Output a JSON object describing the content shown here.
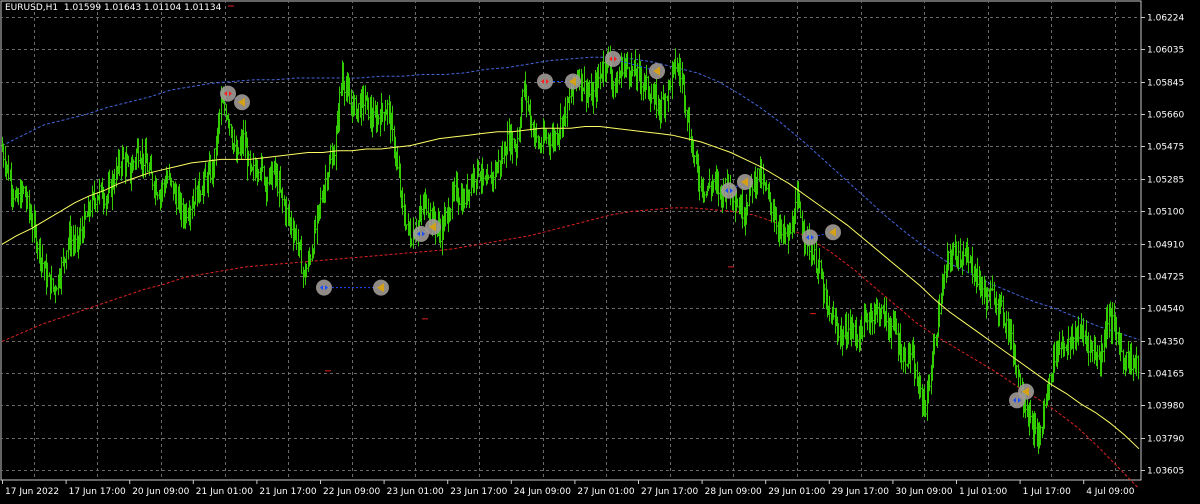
{
  "header": {
    "symbol": "EURUSD,H1",
    "ohlc": "1.01599 1.01643 1.01104 1.01134"
  },
  "chart_data": {
    "type": "line",
    "title": "EURUSD,H1",
    "grid": true,
    "ylim": [
      1.0355,
      1.0632
    ],
    "y_ticks": [
      1.06224,
      1.06035,
      1.05845,
      1.0566,
      1.05475,
      1.05285,
      1.051,
      1.0491,
      1.04725,
      1.0454,
      1.0435,
      1.04165,
      1.0398,
      1.0379,
      1.03605
    ],
    "y_tick_labels": [
      "1.06224",
      "1.06035",
      "1.05845",
      "1.05660",
      "1.05475",
      "1.05285",
      "1.05100",
      "1.04910",
      "1.04725",
      "1.04540",
      "1.04350",
      "1.04165",
      "1.03980",
      "1.03790",
      "1.03605"
    ],
    "x_tick_labels": [
      "17 Jun 2022",
      "17 Jun 17:00",
      "20 Jun 09:00",
      "21 Jun 01:00",
      "21 Jun 17:00",
      "22 Jun 09:00",
      "23 Jun 01:00",
      "23 Jun 17:00",
      "24 Jun 09:00",
      "27 Jun 01:00",
      "27 Jun 17:00",
      "28 Jun 09:00",
      "29 Jun 01:00",
      "29 Jun 17:00",
      "30 Jun 09:00",
      "1 Jul 01:00",
      "1 Jul 17:00",
      "4 Jul 09:00"
    ],
    "colors": {
      "price": "#33cc00",
      "ma": "#ffff66",
      "upper_band": "#4466dd",
      "lower_band": "#dd2222",
      "grid": "#6a6a6a",
      "marker_ring": "#a09a96",
      "buy": "#1a4dff",
      "sell": "#ff2020",
      "close_arrow": "#d4a017"
    },
    "series": [
      {
        "values": [
          1.0548,
          1.0532,
          1.0515,
          1.0522,
          1.0505,
          1.0489,
          1.0472,
          1.0465,
          1.0478,
          1.0495,
          1.049,
          1.0503,
          1.0515,
          1.0522,
          1.0518,
          1.053,
          1.0541,
          1.0532,
          1.0546,
          1.0539,
          1.0528,
          1.0521,
          1.053,
          1.0519,
          1.0508,
          1.0514,
          1.0522,
          1.0528,
          1.0535,
          1.0572,
          1.0566,
          1.054,
          1.0552,
          1.053,
          1.0538,
          1.0527,
          1.0533,
          1.0518,
          1.0505,
          1.0495,
          1.0472,
          1.0488,
          1.0512,
          1.0532,
          1.0545,
          1.059,
          1.0572,
          1.0569,
          1.0575,
          1.0562,
          1.0566,
          1.057,
          1.0545,
          1.051,
          1.0495,
          1.0503,
          1.0516,
          1.0505,
          1.0498,
          1.051,
          1.0522,
          1.0515,
          1.0528,
          1.0535,
          1.0523,
          1.0532,
          1.054,
          1.0553,
          1.0547,
          1.0582,
          1.056,
          1.0547,
          1.0553,
          1.0552,
          1.0563,
          1.0574,
          1.059,
          1.0582,
          1.0575,
          1.0589,
          1.0599,
          1.058,
          1.0595,
          1.0592,
          1.0588,
          1.0584,
          1.0575,
          1.057,
          1.0581,
          1.0595,
          1.0585,
          1.055,
          1.053,
          1.0522,
          1.0527,
          1.052,
          1.0527,
          1.0516,
          1.051,
          1.0525,
          1.0532,
          1.052,
          1.0509,
          1.0496,
          1.0495,
          1.0515,
          1.0498,
          1.0487,
          1.0476,
          1.0452,
          1.0446,
          1.0437,
          1.0443,
          1.0438,
          1.0446,
          1.0452,
          1.0453,
          1.0445,
          1.0442,
          1.0425,
          1.0428,
          1.0408,
          1.0398,
          1.0428,
          1.046,
          1.0483,
          1.0487,
          1.0484,
          1.0479,
          1.047,
          1.046,
          1.0462,
          1.0453,
          1.0442,
          1.042,
          1.0402,
          1.0385,
          1.0378,
          1.0405,
          1.0428,
          1.0435,
          1.0432,
          1.0441,
          1.0438,
          1.043,
          1.0425,
          1.045,
          1.0442,
          1.0426,
          1.0424,
          1.042
        ]
      },
      {
        "values": [
          1.0491,
          1.0496,
          1.05,
          1.0505,
          1.051,
          1.0515,
          1.0519,
          1.0522,
          1.0526,
          1.0529,
          1.0532,
          1.0534,
          1.0536,
          1.0538,
          1.0539,
          1.054,
          1.054,
          1.054,
          1.0541,
          1.0542,
          1.0543,
          1.0544,
          1.0544,
          1.0545,
          1.0545,
          1.0546,
          1.0546,
          1.0547,
          1.0548,
          1.055,
          1.0552,
          1.0553,
          1.0554,
          1.0555,
          1.0556,
          1.0556,
          1.0557,
          1.0558,
          1.0558,
          1.0558,
          1.0559,
          1.0559,
          1.0558,
          1.0557,
          1.0556,
          1.0555,
          1.0554,
          1.0552,
          1.055,
          1.0547,
          1.0544,
          1.054,
          1.0536,
          1.0531,
          1.0526,
          1.052,
          1.0514,
          1.0508,
          1.0502,
          1.0495,
          1.0488,
          1.0481,
          1.0474,
          1.0467,
          1.0459,
          1.0452,
          1.0446,
          1.044,
          1.0434,
          1.0428,
          1.0422,
          1.0416,
          1.041,
          1.0405,
          1.0399,
          1.0394,
          1.0388,
          1.0381,
          1.0373
        ]
      },
      {
        "values": [
          1.0548,
          1.0554,
          1.056,
          1.0563,
          1.0566,
          1.057,
          1.0573,
          1.0576,
          1.058,
          1.0582,
          1.0584,
          1.0585,
          1.0586,
          1.0586,
          1.0587,
          1.0587,
          1.0587,
          1.0587,
          1.0588,
          1.0588,
          1.0589,
          1.0589,
          1.059,
          1.0592,
          1.0593,
          1.0595,
          1.0597,
          1.0598,
          1.0599,
          1.0599,
          1.0598,
          1.0596,
          1.0593,
          1.059,
          1.0585,
          1.0578,
          1.057,
          1.0561,
          1.0551,
          1.054,
          1.0529,
          1.0518,
          1.0507,
          1.0497,
          1.0488,
          1.048,
          1.0474,
          1.0468,
          1.0463,
          1.0458,
          1.0454,
          1.0449,
          1.0444,
          1.044,
          1.0436
        ]
      },
      {
        "values": [
          1.0435,
          1.044,
          1.0445,
          1.0449,
          1.0453,
          1.0457,
          1.0461,
          1.0465,
          1.0468,
          1.0472,
          1.0474,
          1.0476,
          1.0478,
          1.0479,
          1.048,
          1.0481,
          1.0482,
          1.0483,
          1.0484,
          1.0485,
          1.0486,
          1.0487,
          1.0488,
          1.049,
          1.0492,
          1.0494,
          1.0496,
          1.0499,
          1.0502,
          1.0505,
          1.0508,
          1.051,
          1.0511,
          1.0512,
          1.0512,
          1.0511,
          1.051,
          1.0508,
          1.0504,
          1.0499,
          1.0493,
          1.0485,
          1.0476,
          1.0466,
          1.0456,
          1.0446,
          1.0438,
          1.0431,
          1.0424,
          1.0417,
          1.0409,
          1.0402,
          1.0394,
          1.0385,
          1.0374,
          1.0362,
          1.035
        ]
      }
    ],
    "trades": [
      {
        "type": "buy",
        "entry_x": "21 Jun 01:00",
        "entry_y": 1.0578,
        "exit_x": "21 Jun 01:00",
        "exit_y": 1.0573
      },
      {
        "type": "buy",
        "entry_x": "22 Jun 09:00",
        "entry_y": 1.0466,
        "exit_x": "23 Jun 01:00",
        "exit_y": 1.0466
      },
      {
        "type": "buy",
        "entry_x": "23 Jun 01:00",
        "entry_y": 1.0497,
        "exit_x": "23 Jun 01:00",
        "exit_y": 1.0501
      },
      {
        "type": "buy",
        "entry_x": "24 Jun 09:00",
        "entry_y": 1.0585,
        "exit_x": "24 Jun 09:00",
        "exit_y": 1.0585
      },
      {
        "type": "buy",
        "entry_x": "27 Jun 01:00",
        "entry_y": 1.0598,
        "exit_x": "27 Jun 01:00",
        "exit_y": 1.0591
      },
      {
        "type": "buy",
        "entry_x": "28 Jun 09:00",
        "entry_y": 1.0522,
        "exit_x": "28 Jun 09:00",
        "exit_y": 1.0527
      },
      {
        "type": "buy",
        "entry_x": "29 Jun 01:00",
        "entry_y": 1.0495,
        "exit_x": "29 Jun 01:00",
        "exit_y": 1.0498
      },
      {
        "type": "buy",
        "entry_x": "1 Jul 01:00",
        "entry_y": 1.0401,
        "exit_x": "1 Jul 01:00",
        "exit_y": 1.0406
      }
    ]
  }
}
